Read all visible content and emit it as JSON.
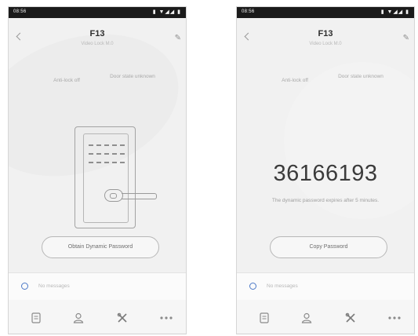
{
  "status_time": "08:56",
  "status_icons": "▮ ▼◢◢ ▮",
  "device_title": "F13",
  "device_subtitle": "Video Lock M.0",
  "stat_left": "Anti-lock off",
  "stat_right": "Door state unknown",
  "left_button": "Obtain Dynamic Password",
  "dynamic_password": "36166193",
  "password_expiry_note": "The dynamic password expires after 5 minutes.",
  "right_button": "Copy Password",
  "message_placeholder": "No messages",
  "icons": {
    "back": "chevron-left-icon",
    "edit": "pencil-icon",
    "message": "message-indicator-icon",
    "tab1": "records-icon",
    "tab2": "user-icon",
    "tab3": "settings-tools-icon",
    "tab4": "more-icon"
  },
  "colors": {
    "accent": "#4d79c7",
    "statusbar": "#1b1b1b",
    "background": "#f1f1f1"
  }
}
